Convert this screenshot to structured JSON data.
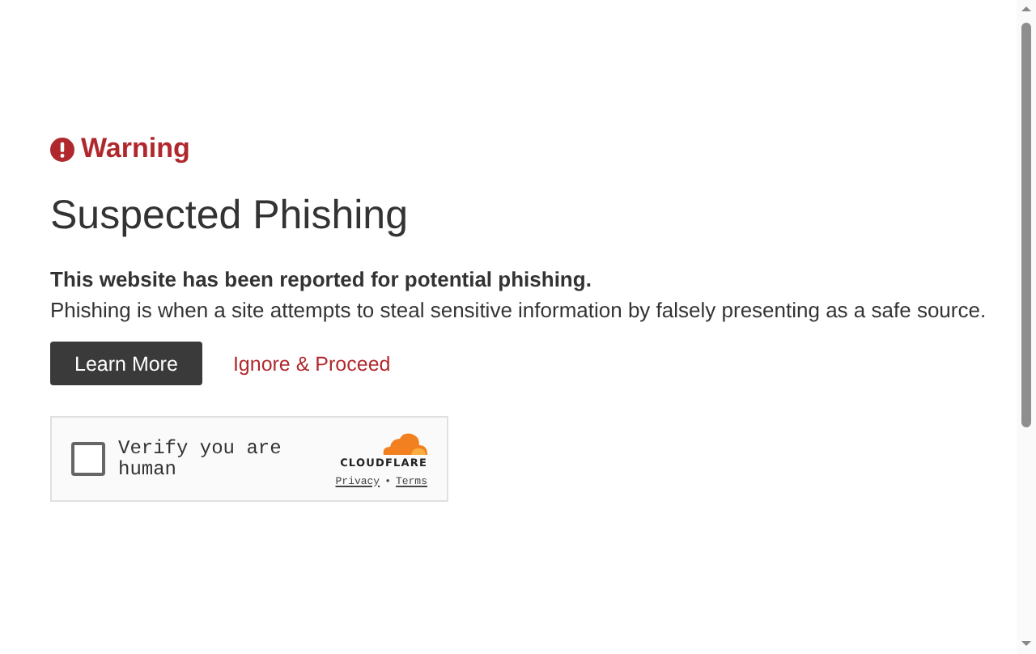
{
  "warning": {
    "label": "Warning"
  },
  "heading": "Suspected Phishing",
  "lead": "This website has been reported for potential phishing.",
  "description": "Phishing is when a site attempts to steal sensitive information by falsely presenting as a safe source.",
  "actions": [
    {
      "kind": "primary",
      "label": "Learn More"
    },
    {
      "kind": "link",
      "label": "Ignore & Proceed"
    }
  ],
  "captcha": {
    "label": "Verify you are human",
    "checked": false,
    "brand": "CLOUDFLARE",
    "links": [
      "Privacy",
      "Terms"
    ],
    "separator": "•"
  }
}
